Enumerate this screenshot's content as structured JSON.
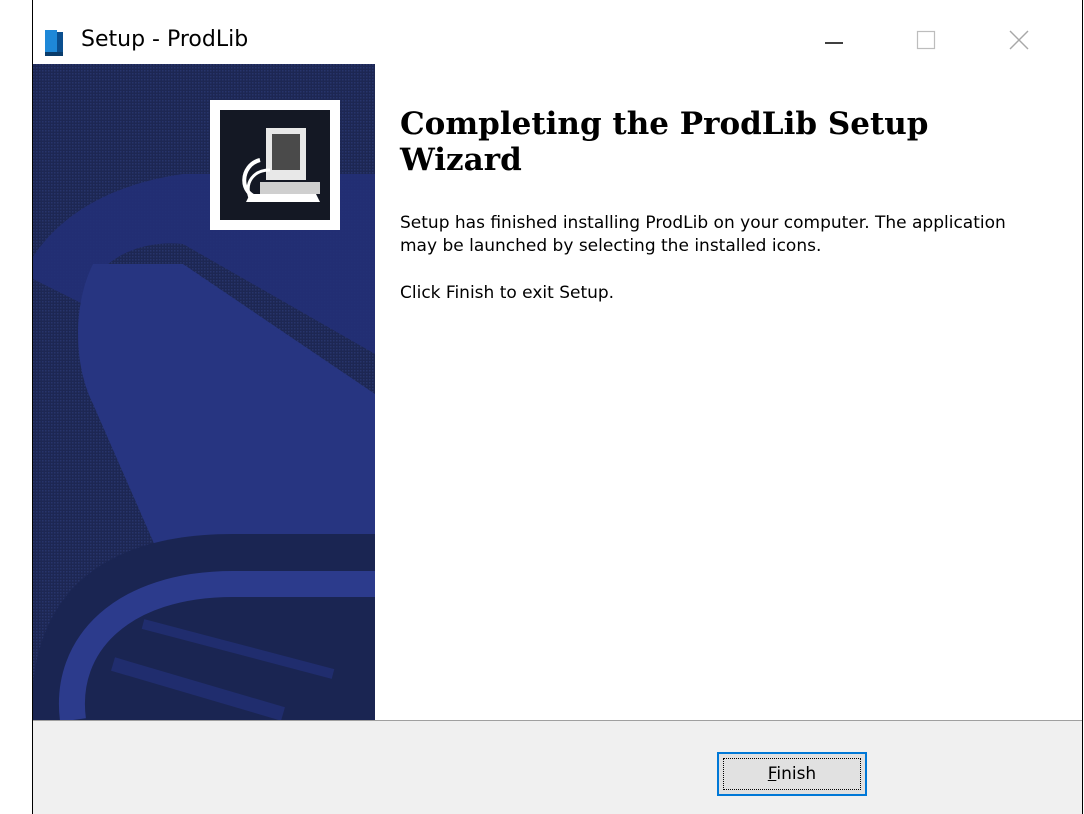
{
  "window": {
    "title": "Setup - ProdLib",
    "icon": "installer-book-icon"
  },
  "controls": {
    "minimize": "minimize-icon",
    "maximize": "maximize-icon",
    "close": "close-icon"
  },
  "main": {
    "heading": "Completing the ProdLib Setup Wizard",
    "paragraph1": "Setup has finished installing ProdLib on your computer. The application may be launched by selecting the installed icons.",
    "paragraph2": "Click Finish to exit Setup."
  },
  "footer": {
    "finish_accel": "F",
    "finish_rest": "inish"
  },
  "colors": {
    "sidebar": "#1d2753",
    "focus_border": "#0078d7"
  }
}
